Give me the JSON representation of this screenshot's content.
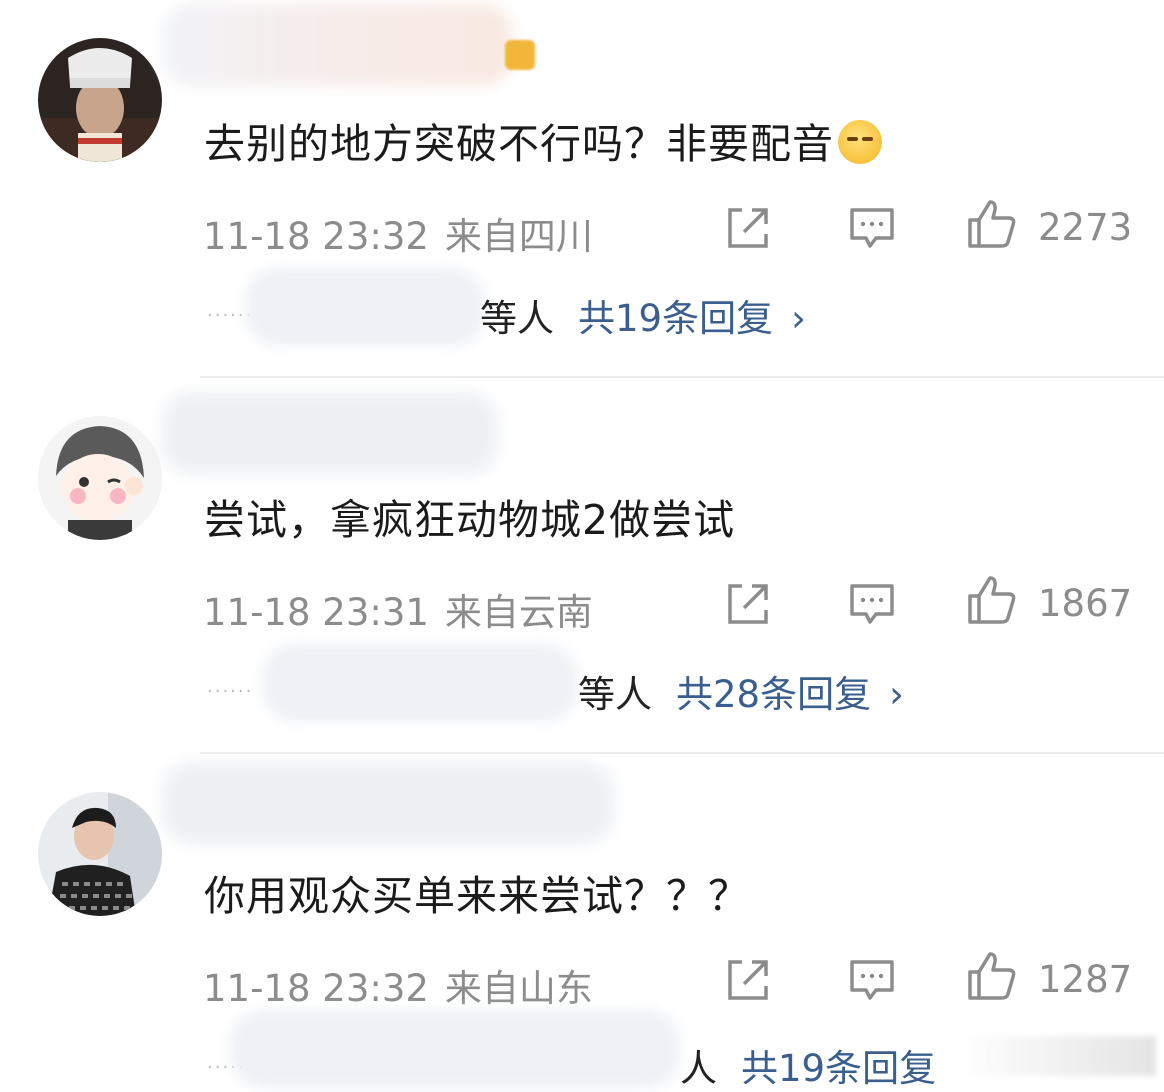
{
  "comments": [
    {
      "text": "去别的地方突破不行吗？非要配音",
      "emoji": "thinking-face-emoji",
      "time": "11-18 23:32",
      "location": "来自四川",
      "likes": "2273",
      "reply_names": "等人",
      "reply_count": "共19条回复",
      "chevron": "›"
    },
    {
      "text": "尝试，拿疯狂动物城2做尝试",
      "time": "11-18 23:31",
      "location": "来自云南",
      "likes": "1867",
      "reply_names": "等人",
      "reply_count": "共28条回复",
      "chevron": "›"
    },
    {
      "text": "你用观众买单来来尝试？？？",
      "time": "11-18 23:32",
      "location": "来自山东",
      "likes": "1287",
      "reply_names": "人",
      "reply_count": "共19条回复",
      "chevron": ""
    }
  ],
  "dots": "......",
  "colors": {
    "reply_link": "#3a5f8f",
    "meta_gray": "#8c8c8c",
    "divider": "#ececec"
  }
}
